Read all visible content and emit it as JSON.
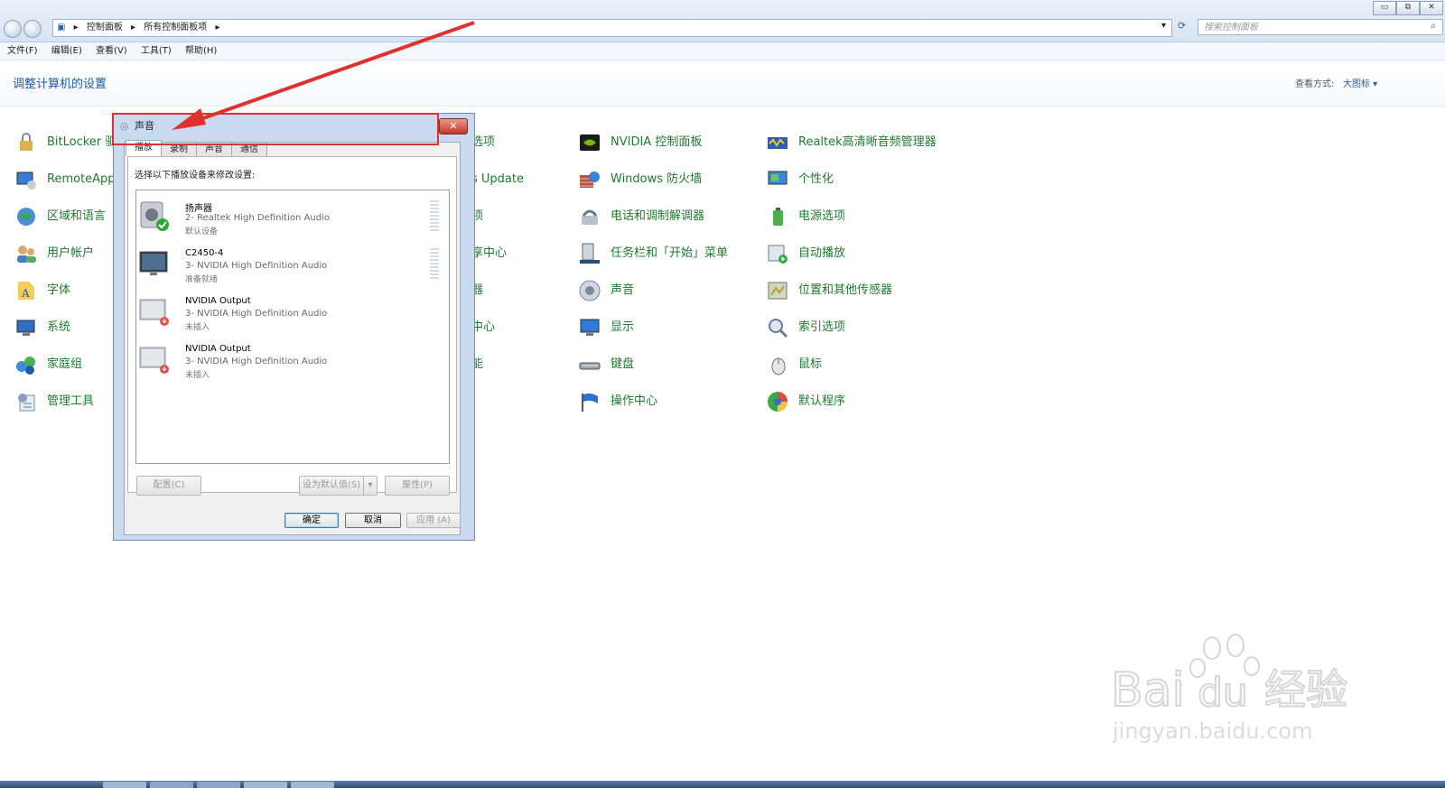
{
  "window": {
    "breadcrumb": [
      "控制面板",
      "所有控制面板项"
    ],
    "search_placeholder": "搜索控制面板",
    "buttons": {
      "minimize": "▭",
      "restore": "⧉",
      "close": "✕"
    }
  },
  "menu": [
    "文件(F)",
    "编辑(E)",
    "查看(V)",
    "工具(T)",
    "帮助(H)"
  ],
  "header": {
    "title": "调整计算机的设置",
    "view_by_label": "查看方式:",
    "view_by_value": "大图标 ▾"
  },
  "items": {
    "col1": [
      "BitLocker 驱",
      "RemoteApp",
      "区域和语言",
      "用户帐户",
      "字体",
      "系统",
      "家庭组",
      "管理工具"
    ],
    "col2": [
      "选项",
      "s Update",
      "项",
      "享中心",
      "器",
      "中心",
      "能"
    ],
    "col3": [
      "NVIDIA 控制面板",
      "Windows 防火墙",
      "电话和调制解调器",
      "任务栏和「开始」菜单",
      "声音",
      "显示",
      "键盘",
      "操作中心"
    ],
    "col4": [
      "Realtek高清晰音频管理器",
      "个性化",
      "电源选项",
      "自动播放",
      "位置和其他传感器",
      "索引选项",
      "鼠标",
      "默认程序"
    ]
  },
  "dialog": {
    "title": "声音",
    "close": "✕",
    "tabs": [
      "播放",
      "录制",
      "声音",
      "通信"
    ],
    "prompt": "选择以下播放设备来修改设置:",
    "devices": [
      {
        "name": "扬声器",
        "desc": "2- Realtek High Definition Audio",
        "status": "默认设备"
      },
      {
        "name": "C2450-4",
        "desc": "3- NVIDIA High Definition Audio",
        "status": "准备就绪"
      },
      {
        "name": "NVIDIA Output",
        "desc": "3- NVIDIA High Definition Audio",
        "status": "未插入"
      },
      {
        "name": "NVIDIA Output",
        "desc": "3- NVIDIA High Definition Audio",
        "status": "未插入"
      }
    ],
    "buttons": {
      "configure": "配置(C)",
      "set_default": "设为默认值(S)",
      "properties": "屋性(P)",
      "ok": "确定",
      "cancel": "取消",
      "apply": "应用 (A)"
    }
  },
  "watermark": {
    "brand": "Bai",
    "brand2": "du",
    "cn": "经验",
    "url": "jingyan.baidu.com"
  },
  "colors": {
    "link_green": "#1e7a2e",
    "heading_blue": "#1e5aa8",
    "annotation_red": "#e0312f"
  }
}
